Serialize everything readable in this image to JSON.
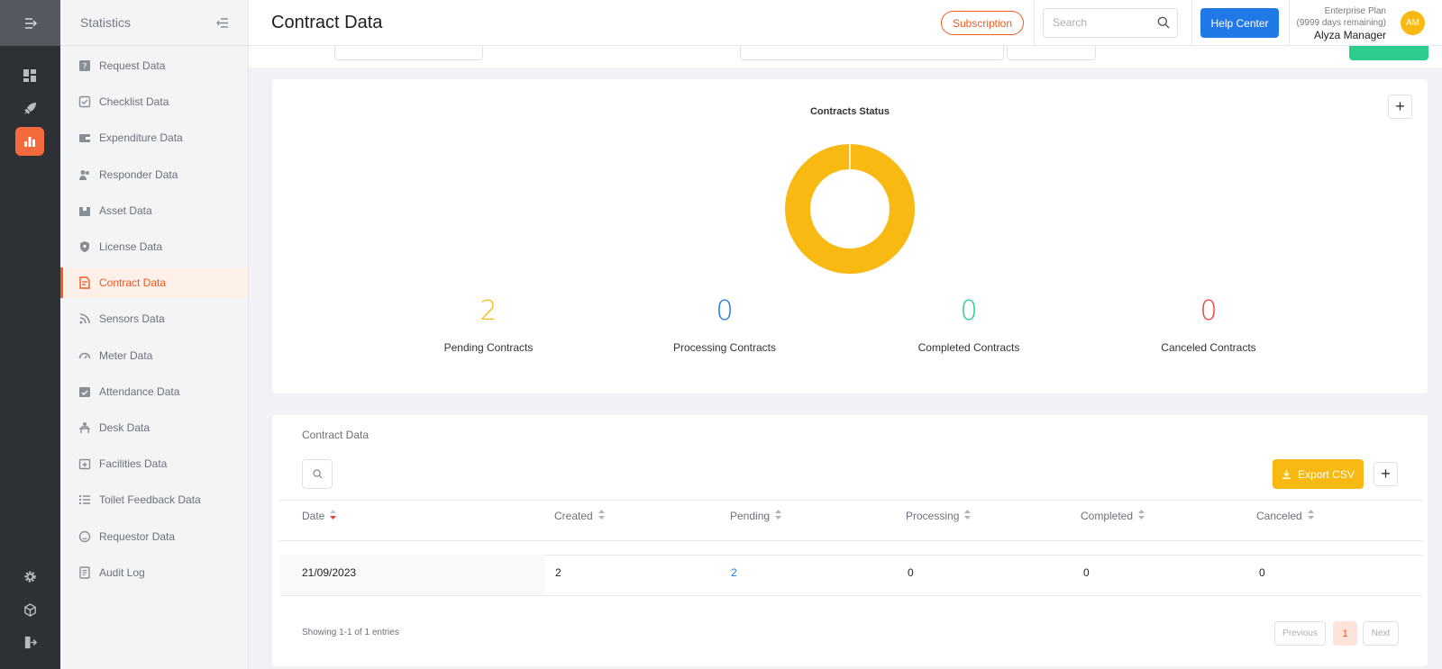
{
  "sidebar": {
    "title": "Statistics",
    "items": [
      {
        "label": "Request Data",
        "icon": "question-square-icon"
      },
      {
        "label": "Checklist Data",
        "icon": "checklist-icon"
      },
      {
        "label": "Expenditure Data",
        "icon": "wallet-icon"
      },
      {
        "label": "Responder Data",
        "icon": "users-icon"
      },
      {
        "label": "Asset Data",
        "icon": "box-icon"
      },
      {
        "label": "License Data",
        "icon": "shield-icon"
      },
      {
        "label": "Contract Data",
        "icon": "contract-icon"
      },
      {
        "label": "Sensors Data",
        "icon": "signal-icon"
      },
      {
        "label": "Meter Data",
        "icon": "gauge-icon"
      },
      {
        "label": "Attendance Data",
        "icon": "check-calendar-icon"
      },
      {
        "label": "Desk Data",
        "icon": "desk-icon"
      },
      {
        "label": "Facilities Data",
        "icon": "calendar-plus-icon"
      },
      {
        "label": "Toilet Feedback Data",
        "icon": "list-icon"
      },
      {
        "label": "Requestor Data",
        "icon": "smile-icon"
      },
      {
        "label": "Audit Log",
        "icon": "document-icon"
      }
    ],
    "active_index": 6
  },
  "header": {
    "title": "Contract Data",
    "subscription_label": "Subscription",
    "search_placeholder": "Search",
    "help_label": "Help Center",
    "plan_name": "Enterprise Plan",
    "plan_remaining": "(9999 days remaining)",
    "user_name": "Alyza Manager",
    "avatar_initials": "AM"
  },
  "status_card": {
    "chart_title": "Contracts Status",
    "stats": [
      {
        "value": "2",
        "label": "Pending Contracts",
        "color": "#f8b913"
      },
      {
        "value": "0",
        "label": "Processing Contracts",
        "color": "#1f7ae8"
      },
      {
        "value": "0",
        "label": "Completed Contracts",
        "color": "#2bcc8d"
      },
      {
        "value": "0",
        "label": "Canceled Contracts",
        "color": "#e8453c"
      }
    ]
  },
  "chart_data": {
    "type": "pie",
    "title": "Contracts Status",
    "categories": [
      "Pending",
      "Processing",
      "Completed",
      "Canceled"
    ],
    "values": [
      2,
      0,
      0,
      0
    ],
    "colors": [
      "#f8b913",
      "#1f7ae8",
      "#2bcc8d",
      "#e8453c"
    ]
  },
  "table_card": {
    "title": "Contract Data",
    "export_label": "Export CSV",
    "columns": [
      "Date",
      "Created",
      "Pending",
      "Processing",
      "Completed",
      "Canceled"
    ],
    "rows": [
      {
        "date": "21/09/2023",
        "created": "2",
        "pending": "2",
        "processing": "0",
        "completed": "0",
        "canceled": "0"
      }
    ],
    "entries_text": "Showing 1-1 of 1 entries",
    "pager": {
      "previous": "Previous",
      "current": "1",
      "next": "Next"
    }
  }
}
